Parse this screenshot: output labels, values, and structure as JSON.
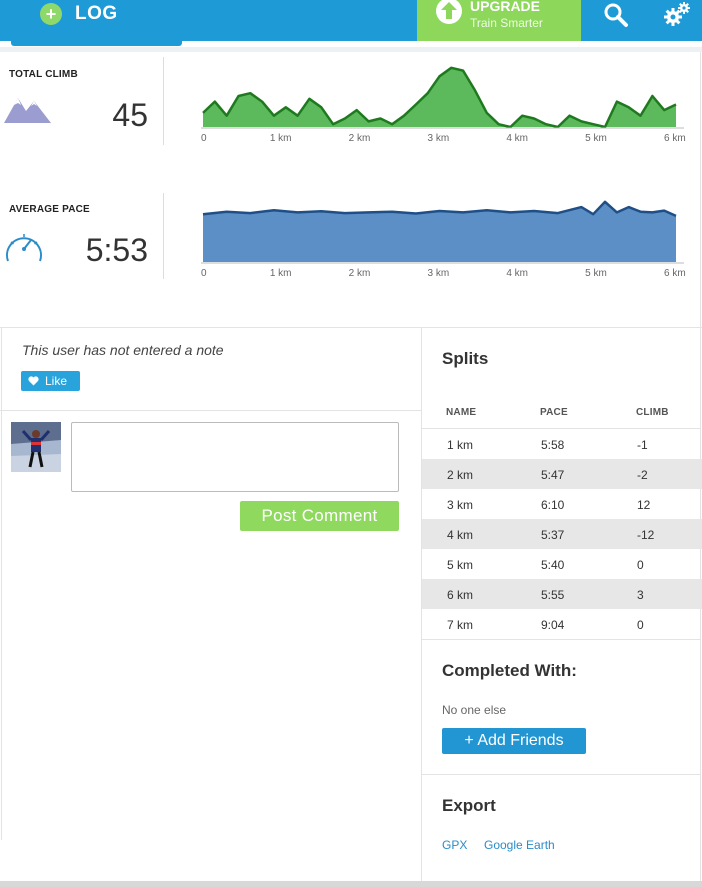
{
  "topbar": {
    "log_label": "LOG",
    "upgrade_title": "UPGRADE",
    "upgrade_subtitle": "Train Smarter",
    "icons": [
      "plus-circle-icon",
      "arrow-up-icon",
      "search-icon",
      "gears-icon"
    ],
    "colors": {
      "bar": "#1e9bd7",
      "upgrade": "#8dd85b"
    }
  },
  "stats": {
    "climb": {
      "label": "TOTAL CLIMB",
      "value": "45",
      "icon": "mountains-icon"
    },
    "pace": {
      "label": "AVERAGE PACE",
      "value": "5:53",
      "icon": "speedometer-icon"
    }
  },
  "chart_data": [
    {
      "type": "area",
      "series": [
        {
          "color": "#5bb85b",
          "x": [
            0,
            0.15,
            0.3,
            0.45,
            0.6,
            0.75,
            0.9,
            1.05,
            1.2,
            1.35,
            1.5,
            1.65,
            1.8,
            1.95,
            2.1,
            2.25,
            2.4,
            2.55,
            2.7,
            2.85,
            3.0,
            3.15,
            3.3,
            3.45,
            3.6,
            3.75,
            3.9,
            4.05,
            4.2,
            4.35,
            4.5,
            4.65,
            4.8,
            4.95,
            5.1,
            5.25,
            5.4,
            5.55,
            5.7,
            5.85,
            6.0
          ],
          "y": [
            5,
            9,
            4,
            11,
            12,
            9,
            4,
            7,
            4,
            10,
            7,
            1,
            3,
            6,
            2,
            3,
            1,
            4,
            8,
            12,
            18,
            21,
            20,
            13,
            5,
            1,
            0,
            4,
            3,
            1,
            0,
            4,
            2,
            1,
            0,
            9,
            7,
            4,
            11,
            6,
            8
          ]
        }
      ],
      "x_ticks": [
        "0",
        "1 km",
        "2 km",
        "3 km",
        "4 km",
        "5 km",
        "6 km"
      ]
    },
    {
      "type": "area",
      "series": [
        {
          "color": "#5b8fc6",
          "x": [
            0,
            0.3,
            0.6,
            0.9,
            1.2,
            1.5,
            1.8,
            2.1,
            2.4,
            2.7,
            3.0,
            3.3,
            3.6,
            3.9,
            4.2,
            4.5,
            4.8,
            4.95,
            5.1,
            5.25,
            5.4,
            5.55,
            5.7,
            5.85,
            6.0
          ],
          "y": [
            5.55,
            5.62,
            5.58,
            5.66,
            5.6,
            5.63,
            5.58,
            5.6,
            5.62,
            5.57,
            5.64,
            5.6,
            5.66,
            5.6,
            5.64,
            5.58,
            5.75,
            5.55,
            5.9,
            5.6,
            5.75,
            5.62,
            5.6,
            5.65,
            5.5
          ]
        }
      ],
      "x_ticks": [
        "0",
        "1 km",
        "2 km",
        "3 km",
        "4 km",
        "5 km",
        "6 km"
      ]
    }
  ],
  "notes": {
    "empty_note": "This user has not entered a note",
    "like_label": "Like",
    "comment_placeholder": "",
    "post_label": "Post Comment"
  },
  "splits": {
    "title": "Splits",
    "headers": [
      "NAME",
      "PACE",
      "CLIMB"
    ],
    "rows": [
      [
        "1 km",
        "5:58",
        "-1"
      ],
      [
        "2 km",
        "5:47",
        "-2"
      ],
      [
        "3 km",
        "6:10",
        "12"
      ],
      [
        "4 km",
        "5:37",
        "-12"
      ],
      [
        "5 km",
        "5:40",
        "0"
      ],
      [
        "6 km",
        "5:55",
        "3"
      ],
      [
        "7 km",
        "9:04",
        "0"
      ]
    ]
  },
  "completed": {
    "title": "Completed With:",
    "none_text": "No one else",
    "add_label": "+ Add Friends"
  },
  "export": {
    "title": "Export",
    "links": [
      "GPX",
      "Google Earth"
    ]
  }
}
